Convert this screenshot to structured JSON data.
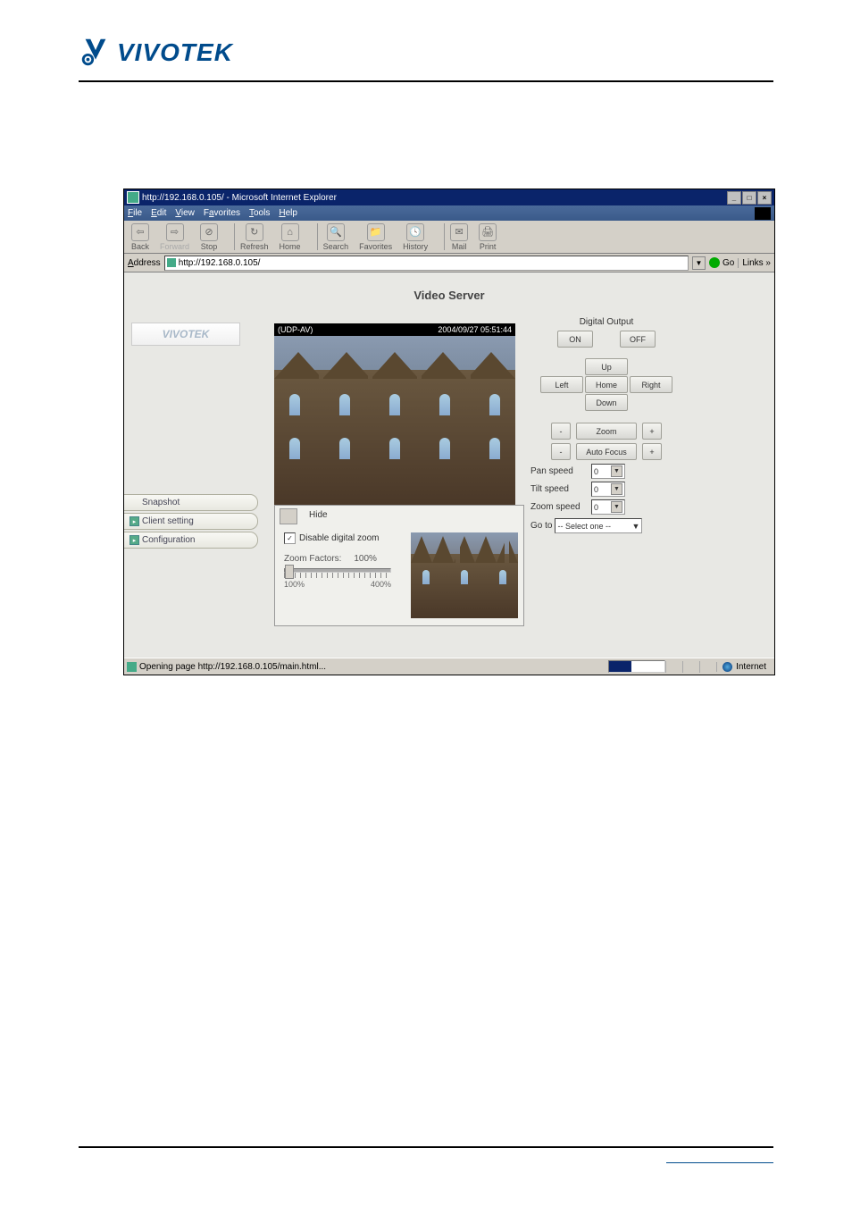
{
  "brand": "VIVOTEK",
  "browser": {
    "title": "http://192.168.0.105/ - Microsoft Internet Explorer",
    "menus": {
      "file": "File",
      "edit": "Edit",
      "view": "View",
      "favorites": "Favorites",
      "tools": "Tools",
      "help": "Help"
    },
    "toolbar": {
      "back": "Back",
      "forward": "Forward",
      "stop": "Stop",
      "refresh": "Refresh",
      "home": "Home",
      "search": "Search",
      "favorites_btn": "Favorites",
      "history": "History",
      "mail": "Mail",
      "print": "Print"
    },
    "address_label": "Address",
    "address_value": "http://192.168.0.105/",
    "go": "Go",
    "links": "Links »"
  },
  "app": {
    "title": "Video Server",
    "logo": "VIVOTEK",
    "sidebar": {
      "snapshot": "Snapshot",
      "client": "Client setting",
      "config": "Configuration"
    },
    "video": {
      "protocol": "(UDP-AV)",
      "timestamp": "2004/09/27 05:51:44"
    },
    "zoom_popup": {
      "hide": "Hide",
      "disable": "Disable digital zoom",
      "factors_label": "Zoom Factors:",
      "factors_value": "100%",
      "min": "100%",
      "max": "400%"
    },
    "right": {
      "digital_output": "Digital Output",
      "on": "ON",
      "off": "OFF",
      "up": "Up",
      "down": "Down",
      "left": "Left",
      "right": "Right",
      "home": "Home",
      "zoom": "Zoom",
      "auto_focus": "Auto Focus",
      "minus": "-",
      "plus": "+",
      "pan_speed": "Pan speed",
      "tilt_speed": "Tilt speed",
      "zoom_speed": "Zoom speed",
      "speed_val": "0",
      "goto": "Go to",
      "goto_value": "-- Select one --"
    }
  },
  "status": {
    "loading": "Opening page http://192.168.0.105/main.html...",
    "zone": "Internet"
  }
}
